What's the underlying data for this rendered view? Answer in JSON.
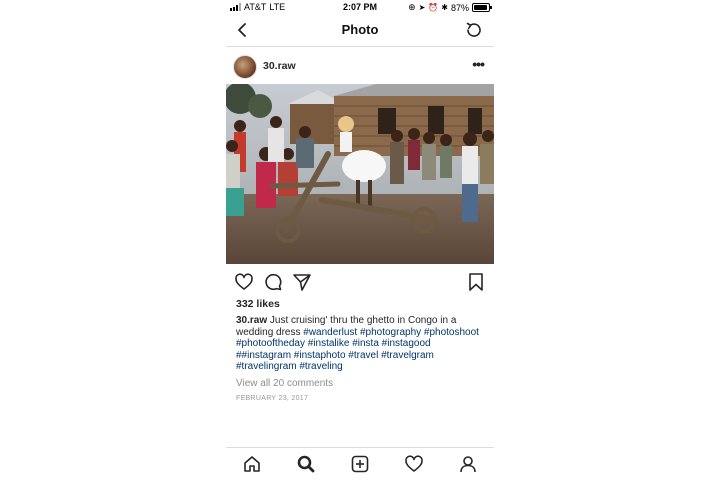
{
  "status_bar": {
    "carrier": "AT&T",
    "network": "LTE",
    "time": "2:07 PM",
    "battery": "87%",
    "battery_level": 0.87
  },
  "nav": {
    "title": "Photo",
    "back_icon": "chevron-left-icon",
    "refresh_icon": "refresh-icon"
  },
  "post": {
    "username": "30.raw",
    "likes": "332 likes",
    "caption_user": "30.raw",
    "caption_text": " Just cruising' thru the ghetto in Congo in a wedding dress ",
    "caption_tags": "#wanderlust #photography #photoshoot #photooftheday #instalike #insta #instagood ##instagram #instaphoto #travel #travelgram #travelingram #traveling",
    "comments_link": "View all 20 comments",
    "date": "FEBRUARY 23, 2017"
  },
  "icons": {
    "like": "heart-icon",
    "comment": "comment-icon",
    "share": "send-icon",
    "save": "bookmark-icon",
    "more": "more-options-icon"
  },
  "tabs": [
    "home-icon",
    "search-icon",
    "add-icon",
    "activity-heart-icon",
    "profile-icon"
  ],
  "more_glyph": "•••"
}
